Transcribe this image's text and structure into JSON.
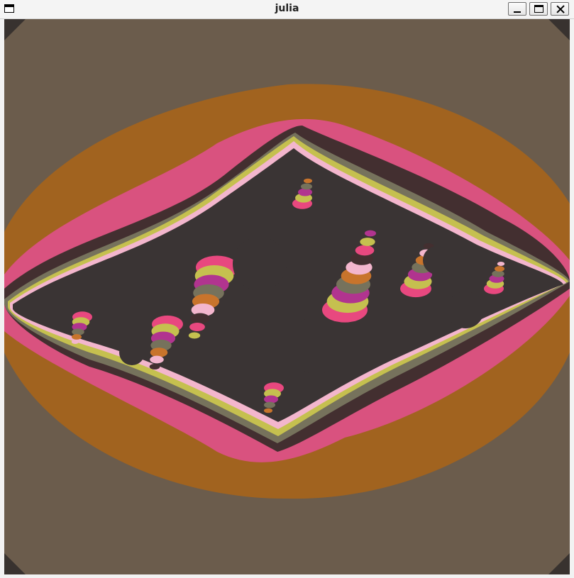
{
  "window": {
    "title": "julia",
    "menu_icon": "window-menu-icon",
    "buttons": {
      "minimize_icon": "minimize-icon",
      "maximize_icon": "maximize-icon",
      "close_icon": "close-icon"
    }
  },
  "fractal": {
    "type": "julia-set",
    "colors": {
      "outer": "#6b5c4c",
      "band1": "#a1631f",
      "band2": "#d9527f",
      "band3": "#432f30",
      "band4": "#76725c",
      "band5": "#c5c04f",
      "band6": "#f3b6cd",
      "interior": "#3a3434",
      "accent_magenta": "#b1348f",
      "accent_pink": "#e8487f",
      "accent_orange": "#c8742c",
      "corner": "#38322f"
    }
  }
}
